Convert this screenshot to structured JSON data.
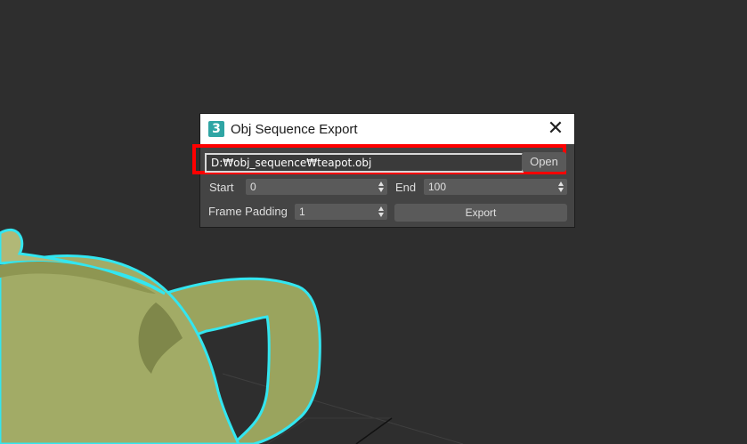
{
  "dialog": {
    "title": "Obj Sequence Export",
    "app_icon_glyph": "3",
    "close_glyph": "✕",
    "file_path": "D:₩obj_sequence₩teapot.obj",
    "open_label": "Open",
    "start_label": "Start",
    "start_value": "0",
    "end_label": "End",
    "end_value": "100",
    "frame_padding_label": "Frame Padding",
    "frame_padding_value": "1",
    "export_label": "Export"
  },
  "colors": {
    "viewport_bg": "#2e2e2e",
    "teapot_fill": "#9aa45e",
    "selection_outline": "#33e6f0",
    "highlight_box": "#ff0000"
  },
  "icons": [
    "app-3dsmax-icon",
    "close-icon",
    "spinner-arrows-icon"
  ]
}
